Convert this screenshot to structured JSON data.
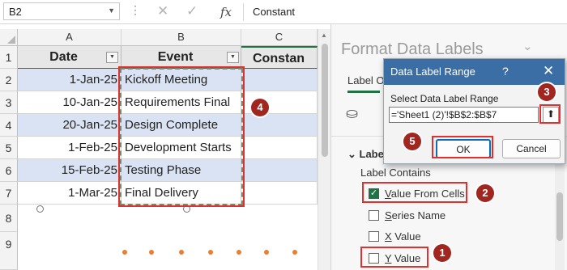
{
  "formula_bar": {
    "name_box": "B2",
    "content": "Constant"
  },
  "sheet": {
    "columns": [
      "A",
      "B",
      "C"
    ],
    "rows": [
      "1",
      "2",
      "3",
      "4",
      "5",
      "6",
      "7",
      "8",
      "9"
    ],
    "headers": {
      "date": "Date",
      "event": "Event",
      "constant": "Constan"
    },
    "data": [
      {
        "date": "1-Jan-25",
        "event": "Kickoff Meeting"
      },
      {
        "date": "10-Jan-25",
        "event": "Requirements Final"
      },
      {
        "date": "20-Jan-25",
        "event": "Design Complete"
      },
      {
        "date": "1-Feb-25",
        "event": "Development Starts"
      },
      {
        "date": "15-Feb-25",
        "event": "Testing Phase"
      },
      {
        "date": "1-Mar-25",
        "event": "Final Delivery"
      }
    ]
  },
  "format_pane": {
    "title": "Format Data Labels",
    "tab": "Label Op",
    "section": "Labe",
    "label_contains": "Label Contains",
    "options": [
      {
        "pre": "",
        "u": "V",
        "post": "alue From Cells",
        "checked": true
      },
      {
        "pre": "",
        "u": "S",
        "post": "eries Name",
        "checked": false
      },
      {
        "pre": "",
        "u": "X",
        "post": " Value",
        "checked": false
      },
      {
        "pre": "",
        "u": "Y",
        "post": " Value",
        "checked": false
      }
    ]
  },
  "dialog": {
    "title": "Data Label Range",
    "help": "?",
    "prompt": "Select Data Label Range",
    "range_value": "='Sheet1 (2)'!$B$2:$B$7",
    "ok_label": "OK",
    "cancel_label": "Cancel"
  },
  "annotations": {
    "badge_1": "1",
    "badge_2": "2",
    "badge_3": "3",
    "badge_4": "4",
    "badge_5": "5"
  },
  "colors": {
    "accent_green": "#217346",
    "band_blue": "#dae3f3",
    "badge_red": "#a1261f",
    "highlight_red": "#e03030",
    "marker_orange": "#ed7d31",
    "dialog_title_blue": "#3b6ea5"
  }
}
